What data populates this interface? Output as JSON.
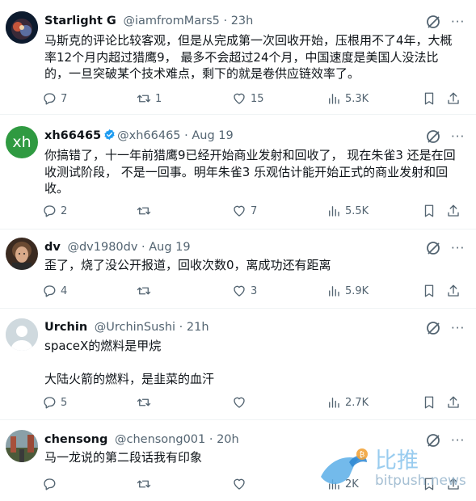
{
  "tweets": [
    {
      "name": "Starlight G",
      "handle": "@iamfromMars5 · 23h",
      "verified": false,
      "text": "马斯克的评论比较客观，但是从完成第一次回收开始，压根用不了4年，大概率12个月内超过猎鹰9， 最多不会超过24个月，中国速度是美国人没法比的，一旦突破某个技术难点，剩下的就是卷供应链效率了。",
      "replies": "7",
      "reposts": "1",
      "likes": "15",
      "views": "5.3K"
    },
    {
      "name": "xh66465",
      "handle": "@xh66465 · Aug 19",
      "verified": true,
      "avatar_text": "xh",
      "text": "你搞错了，十一年前猎鹰9已经开始商业发射和回收了， 现在朱雀3 还是在回收测试阶段， 不是一回事。明年朱雀3 乐观估计能开始正式的商业发射和回收。",
      "replies": "2",
      "reposts": "",
      "likes": "7",
      "views": "5.5K"
    },
    {
      "name": "dv",
      "handle": "@dv1980dv · Aug 19",
      "verified": false,
      "text": "歪了，烧了没公开报道，回收次数0，离成功还有距离",
      "replies": "4",
      "reposts": "",
      "likes": "3",
      "views": "5.9K"
    },
    {
      "name": "Urchin",
      "handle": "@UrchinSushi · 21h",
      "verified": false,
      "text_line1": "spaceX的燃料是甲烷",
      "text_line2": "大陆火箭的燃料，是韭菜的血汗",
      "replies": "5",
      "reposts": "",
      "likes": "",
      "views": "2.7K"
    },
    {
      "name": "chensong",
      "handle": "@chensong001 · 20h",
      "verified": false,
      "text": "马一龙说的第二段话我有印象",
      "replies": "",
      "reposts": "",
      "likes": "",
      "views": "2K"
    }
  ],
  "watermark": {
    "cn": "比推",
    "en": "bitpush.news"
  },
  "colors": {
    "accent": "#1d9bf0",
    "muted": "#536471",
    "xh_avatar": "#2f9a41"
  }
}
